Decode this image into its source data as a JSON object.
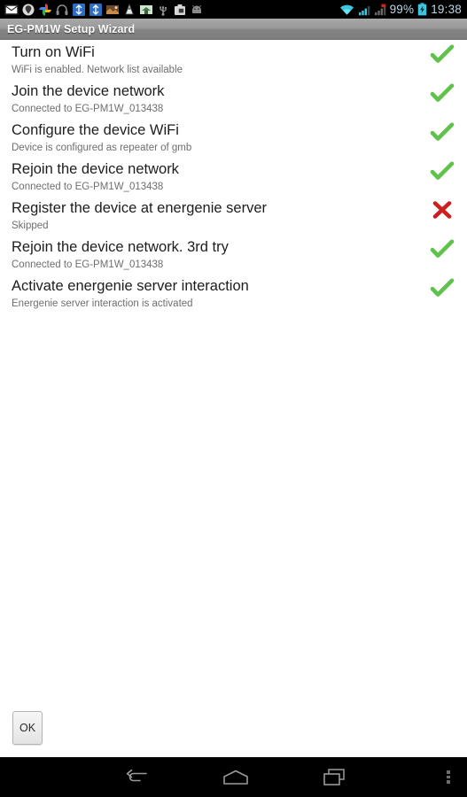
{
  "statusbar": {
    "app_icons": [
      "gmail-icon",
      "location-pin-icon",
      "google-photos-icon",
      "headphones-icon",
      "sync-blue-icon",
      "sync-blue-icon-2",
      "photo-icon",
      "vlc-cone-icon",
      "home-photo-icon",
      "usb-icon",
      "camera-bag-icon",
      "android-icon"
    ],
    "wifi_icon": "wifi-icon",
    "signal_icon": "signal-bars-icon",
    "signal_icon_2": "signal-bars-no-service-icon",
    "battery_percent": "99%",
    "battery_icon": "battery-charging-icon",
    "clock": "19:38",
    "text_color": "#b9d6e4"
  },
  "titlebar": {
    "title": "EG-PM1W Setup Wizard"
  },
  "colors": {
    "success": "#5fc24a",
    "failure": "#cc2020",
    "background": "#ffffff",
    "title_text": "#1d1d1d",
    "subtitle_text": "#6e6e6e"
  },
  "steps": [
    {
      "title": "Turn on WiFi",
      "subtitle": "WiFi is enabled. Network list available",
      "status": "success",
      "status_icon": "check-icon"
    },
    {
      "title": "Join the device network",
      "subtitle": "Connected to EG-PM1W_013438",
      "status": "success",
      "status_icon": "check-icon"
    },
    {
      "title": "Configure the device WiFi",
      "subtitle": "Device is configured as repeater of gmb",
      "status": "success",
      "status_icon": "check-icon"
    },
    {
      "title": "Rejoin the device network",
      "subtitle": "Connected to EG-PM1W_013438",
      "status": "success",
      "status_icon": "check-icon"
    },
    {
      "title": "Register the device at energenie server",
      "subtitle": "Skipped",
      "status": "failure",
      "status_icon": "cross-icon"
    },
    {
      "title": "Rejoin the device network. 3rd try",
      "subtitle": "Connected to EG-PM1W_013438",
      "status": "success",
      "status_icon": "check-icon"
    },
    {
      "title": "Activate energenie server interaction",
      "subtitle": "Energenie server interaction is activated",
      "status": "success",
      "status_icon": "check-icon"
    }
  ],
  "footer": {
    "ok_label": "OK"
  },
  "navbar": {
    "back_label": "Back",
    "home_label": "Home",
    "recents_label": "Recent apps",
    "menu_label": "Menu"
  }
}
